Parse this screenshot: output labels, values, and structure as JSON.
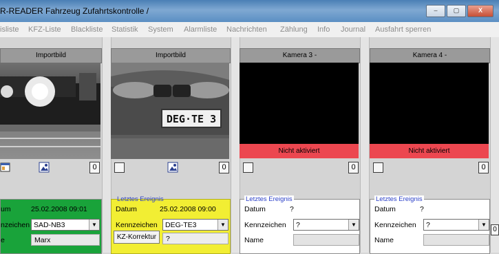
{
  "window": {
    "title": "R-READER  Fahrzeug Zufahrtskontrolle  /",
    "buttons": [
      "–",
      "▢",
      "X"
    ]
  },
  "menu": [
    "isliste",
    "KFZ-Liste",
    "Blackliste",
    "Statistik",
    "System",
    "Alarmliste",
    "Nachrichten",
    "Zählung",
    "Info",
    "Journal",
    "Ausfahrt sperren"
  ],
  "cameras": [
    {
      "header": "Importbild",
      "status": "",
      "counter": "0"
    },
    {
      "header": "Importbild",
      "status": "",
      "counter": "0",
      "plate_text": "DEG·TE 3"
    },
    {
      "header": "Kamera 3 -",
      "status": "Nicht aktiviert",
      "counter": "0"
    },
    {
      "header": "Kamera 4 -",
      "status": "Nicht aktiviert",
      "counter": "0"
    }
  ],
  "events": [
    {
      "legend": "",
      "datum_label": "um",
      "datum": "25.02.2008 09:01",
      "kenn_label": "nzeichen",
      "kenn": "SAD-NB3",
      "name_label": "e",
      "name": "Marx",
      "bg": "#19a33a"
    },
    {
      "legend": "Letztes Ereignis",
      "datum_label": "Datum",
      "datum": "25.02.2008 09:00",
      "kenn_label": "Kennzeichen",
      "kenn": "DEG-TE3",
      "button": "KZ-Korrektur",
      "name": "?",
      "bg": "#f2ee33"
    },
    {
      "legend": "Letztes Ereignis",
      "datum_label": "Datum",
      "datum": "?",
      "kenn_label": "Kennzeichen",
      "kenn": "?",
      "name_label": "Name",
      "name": "",
      "bg": "#ffffff"
    },
    {
      "legend": "Letztes Ereignis",
      "datum_label": "Datum",
      "datum": "?",
      "kenn_label": "Kennzeichen",
      "kenn": "?",
      "name_label": "Name",
      "name": "",
      "bg": "#ffffff"
    }
  ],
  "colors": {
    "status_red": "#ec4750",
    "legend_blue": "#2a3fc8",
    "green_event": "#19a33a",
    "yellow_event": "#f2ee33"
  },
  "icons": [
    "camera-settings-icon",
    "snapshot-icon"
  ]
}
